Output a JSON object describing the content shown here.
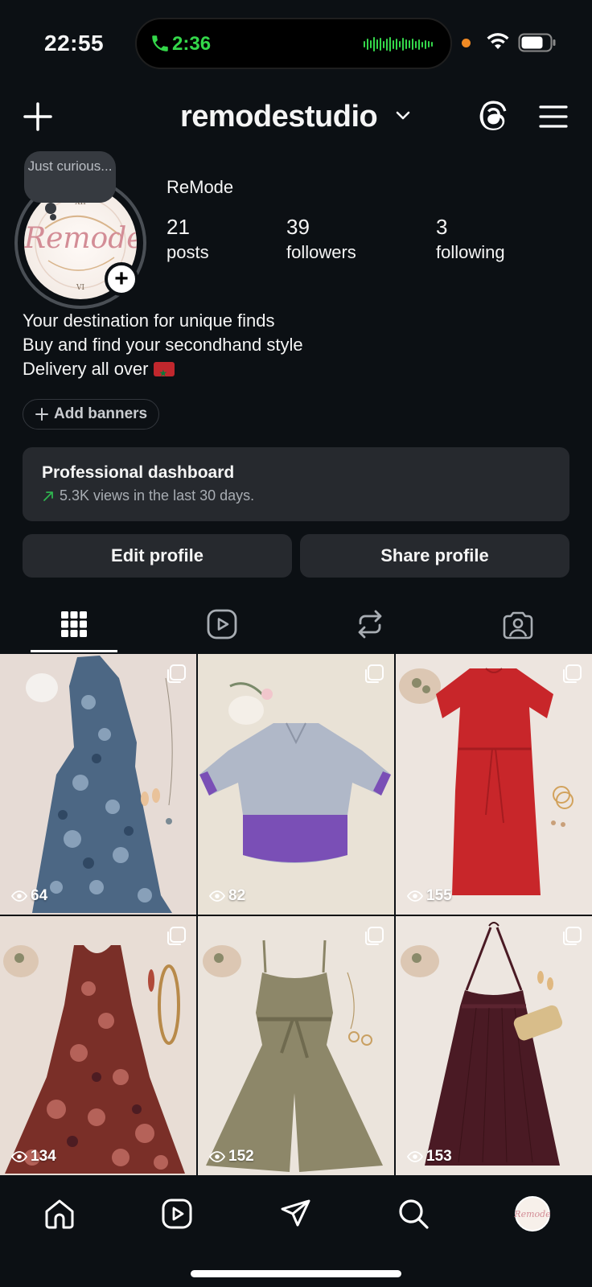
{
  "status_bar": {
    "time": "22:55",
    "call_time": "2:36",
    "icons": [
      "phone-icon",
      "waveform-icon",
      "mic-indicator-dot",
      "wifi-icon",
      "battery-icon"
    ]
  },
  "header": {
    "username": "remodestudio",
    "icons": [
      "plus-icon",
      "chevron-down-icon",
      "threads-icon",
      "menu-icon"
    ]
  },
  "profile": {
    "note": "Just curious...",
    "avatar_text": "Remode",
    "display_name": "ReMode",
    "stats": [
      {
        "value": "21",
        "label": "posts"
      },
      {
        "value": "39",
        "label": "followers"
      },
      {
        "value": "3",
        "label": "following"
      }
    ],
    "bio": [
      "Your destination for unique finds",
      "Buy and find your secondhand style",
      "Delivery all over"
    ],
    "add_banners": "Add banners"
  },
  "dashboard": {
    "title": "Professional dashboard",
    "subtitle": "5.3K views in the last 30 days."
  },
  "actions": {
    "edit": "Edit profile",
    "share": "Share profile"
  },
  "tabs": [
    "grid-icon",
    "reels-icon",
    "reposts-icon",
    "tagged-icon"
  ],
  "posts": [
    {
      "views": "64",
      "desc": "blue floral maxi dress",
      "color": "#3b5a7a"
    },
    {
      "views": "82",
      "desc": "grey and purple blouse",
      "color": "#9aa2b4"
    },
    {
      "views": "155",
      "desc": "red midi dress",
      "color": "#c8262a"
    },
    {
      "views": "134",
      "desc": "rust print sleeveless dress",
      "color": "#7a3a2e"
    },
    {
      "views": "152",
      "desc": "olive jumpsuit",
      "color": "#8a8466"
    },
    {
      "views": "153",
      "desc": "burgundy halter maxi dress",
      "color": "#4a1a24"
    }
  ],
  "bottom_nav": [
    "home-icon",
    "reels-icon",
    "messages-icon",
    "search-icon",
    "profile-avatar"
  ],
  "colors": {
    "background": "#0c1014",
    "card": "#26292e",
    "call_green": "#34d74a",
    "trend_green": "#2fb44f"
  }
}
